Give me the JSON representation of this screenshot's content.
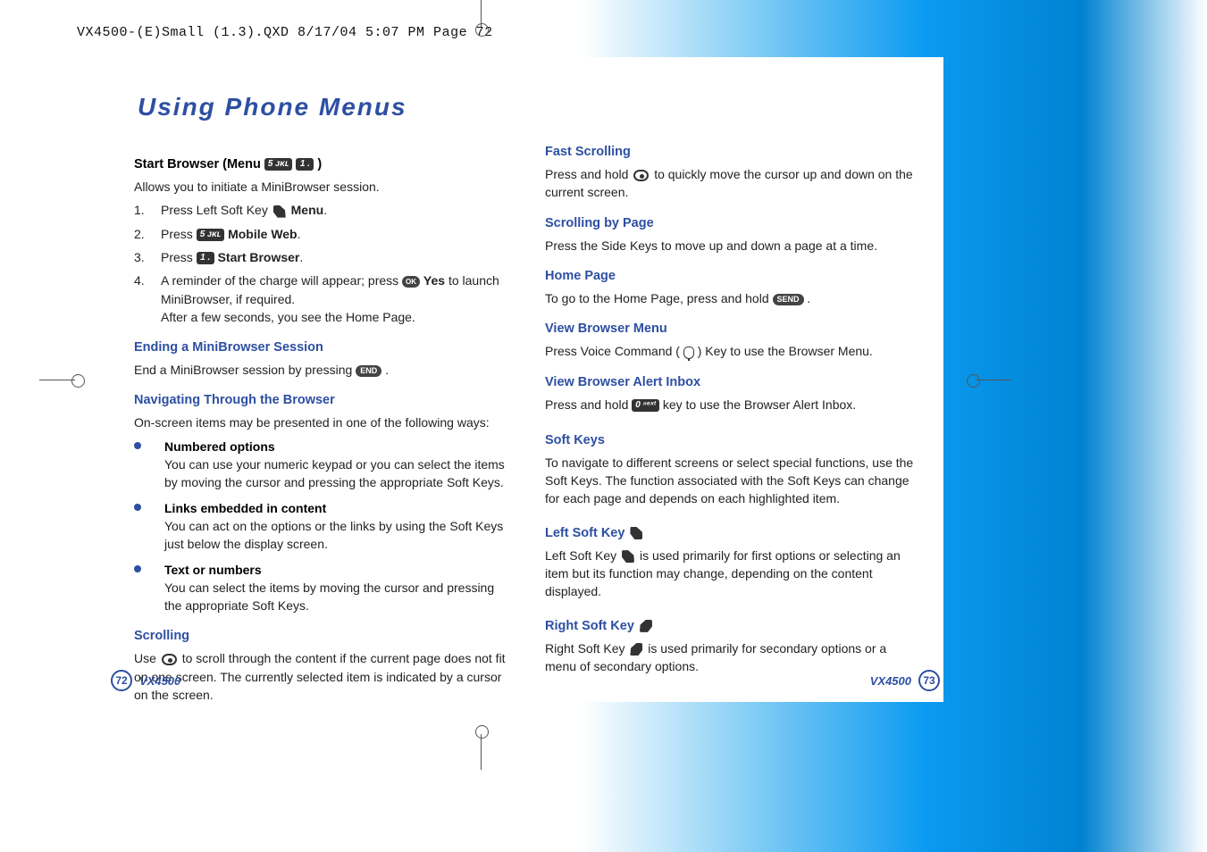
{
  "meta_header": "VX4500-(E)Small (1.3).QXD  8/17/04  5:07 PM  Page 72",
  "title": "Using Phone Menus",
  "left": {
    "h_start_browser": "Start Browser (Menu ",
    "h_start_browser_close": " )",
    "key_5": "5 ᴊᴋʟ",
    "key_1": "1 .",
    "p_allows": "Allows you to initiate a MiniBrowser session.",
    "step1_pre": "Press Left Soft Key ",
    "step1_post": " Menu",
    "step2_pre": "Press ",
    "step2_post": " Mobile Web",
    "step3_pre": "Press ",
    "step3_post": " Start Browser",
    "step4_pre": "A reminder of the charge will appear; press ",
    "step4_yes": " Yes",
    "step4_mid": " to launch MiniBrowser, if required.",
    "step4_after": "After a few seconds, you see the Home Page.",
    "h_ending": "Ending a MiniBrowser Session",
    "p_ending": "End a MiniBrowser session by pressing ",
    "h_nav": "Navigating Through the Browser",
    "p_nav": "On-screen items may be presented in one of the following ways:",
    "b1_title": "Numbered options",
    "b1_body": "You can use your numeric keypad or you can select the items by moving the cursor and pressing the appropriate Soft Keys.",
    "b2_title": "Links embedded in content",
    "b2_body": "You can act on the options or the links by using the Soft Keys just below the display screen.",
    "b3_title": "Text or numbers",
    "b3_body": "You can select the items by moving the cursor and pressing the appropriate Soft Keys.",
    "h_scroll": "Scrolling",
    "p_scroll_pre": "Use ",
    "p_scroll_post": " to scroll through the content if the current page does not fit on one screen. The currently selected item is indicated by a cursor on the screen."
  },
  "right": {
    "h_fast": "Fast Scrolling",
    "p_fast_pre": "Press and hold ",
    "p_fast_post": " to quickly move the cursor up and down on the current screen.",
    "h_page": "Scrolling by Page",
    "p_page": "Press the Side Keys to move up and down a page at a time.",
    "h_home": "Home Page",
    "p_home_pre": "To go to the Home Page, press and hold ",
    "send_label": "SEND",
    "h_view_menu": "View Browser Menu",
    "p_view_menu_pre": "Press Voice Command (",
    "p_view_menu_post": ") Key  to use the Browser Menu.",
    "h_alert": "View Browser Alert Inbox",
    "p_alert_pre": "Press and hold ",
    "key_0": "0 ⁿᵉˣᵗ",
    "p_alert_post": " key to use the Browser Alert Inbox.",
    "h_softkeys": "Soft Keys",
    "p_softkeys": "To navigate to different screens or select special functions, use the Soft Keys. The function associated with the Soft Keys can change for each page and depends on each highlighted item.",
    "h_left_soft": "Left Soft Key ",
    "p_left_soft_pre": "Left Soft Key ",
    "p_left_soft_post": " is used primarily for first options or selecting an item but its function may change, depending on the content displayed.",
    "h_right_soft": "Right Soft Key ",
    "p_right_soft_pre": "Right Soft Key ",
    "p_right_soft_post": " is used primarily for secondary options or a menu of secondary options."
  },
  "footer": {
    "page_left": "72",
    "page_right": "73",
    "model": "VX4500"
  },
  "icons": {
    "end_label": "END",
    "ok_label": "OK"
  }
}
